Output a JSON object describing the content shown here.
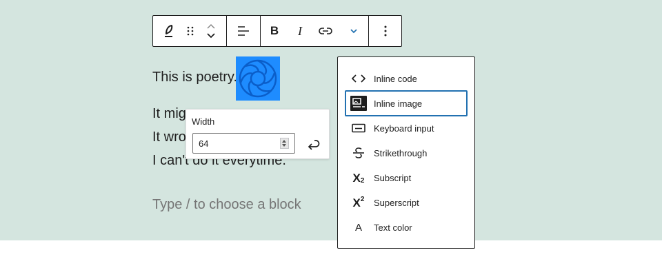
{
  "toolbar": {
    "buttons": [
      {
        "name": "change-block-type",
        "icon": "feather-icon"
      },
      {
        "name": "drag-handle",
        "icon": "drag-dots-icon"
      },
      {
        "name": "move-up-down",
        "icon": "chevron-up-down-icon"
      },
      {
        "name": "align-text",
        "icon": "align-left-icon"
      },
      {
        "name": "bold",
        "icon": "bold-icon"
      },
      {
        "name": "italic",
        "icon": "italic-icon"
      },
      {
        "name": "link",
        "icon": "link-icon"
      },
      {
        "name": "more-rich-text",
        "icon": "chevron-down-icon"
      },
      {
        "name": "options",
        "icon": "vertical-ellipsis-icon"
      }
    ]
  },
  "editor": {
    "line1": "This is poetry.",
    "line2": "It mig",
    "line3": "It wro",
    "line4": "I can't do it everytime.",
    "placeholder": "Type / to choose a block"
  },
  "width_popover": {
    "label": "Width",
    "value": "64"
  },
  "menu": {
    "items": [
      {
        "label": "Inline code",
        "icon": "code-icon"
      },
      {
        "label": "Inline image",
        "icon": "image-icon",
        "selected": true
      },
      {
        "label": "Keyboard input",
        "icon": "keyboard-icon"
      },
      {
        "label": "Strikethrough",
        "icon": "strikethrough-icon"
      },
      {
        "label": "Subscript",
        "icon": "subscript-icon",
        "glyph": "X",
        "mark": "2"
      },
      {
        "label": "Superscript",
        "icon": "superscript-icon",
        "glyph": "X",
        "mark": "2"
      },
      {
        "label": "Text color",
        "icon": "text-color-icon",
        "glyph": "A"
      }
    ]
  },
  "colors": {
    "canvas": "#d4e5df",
    "accent": "#2271b1",
    "image": "#1e8cff"
  }
}
